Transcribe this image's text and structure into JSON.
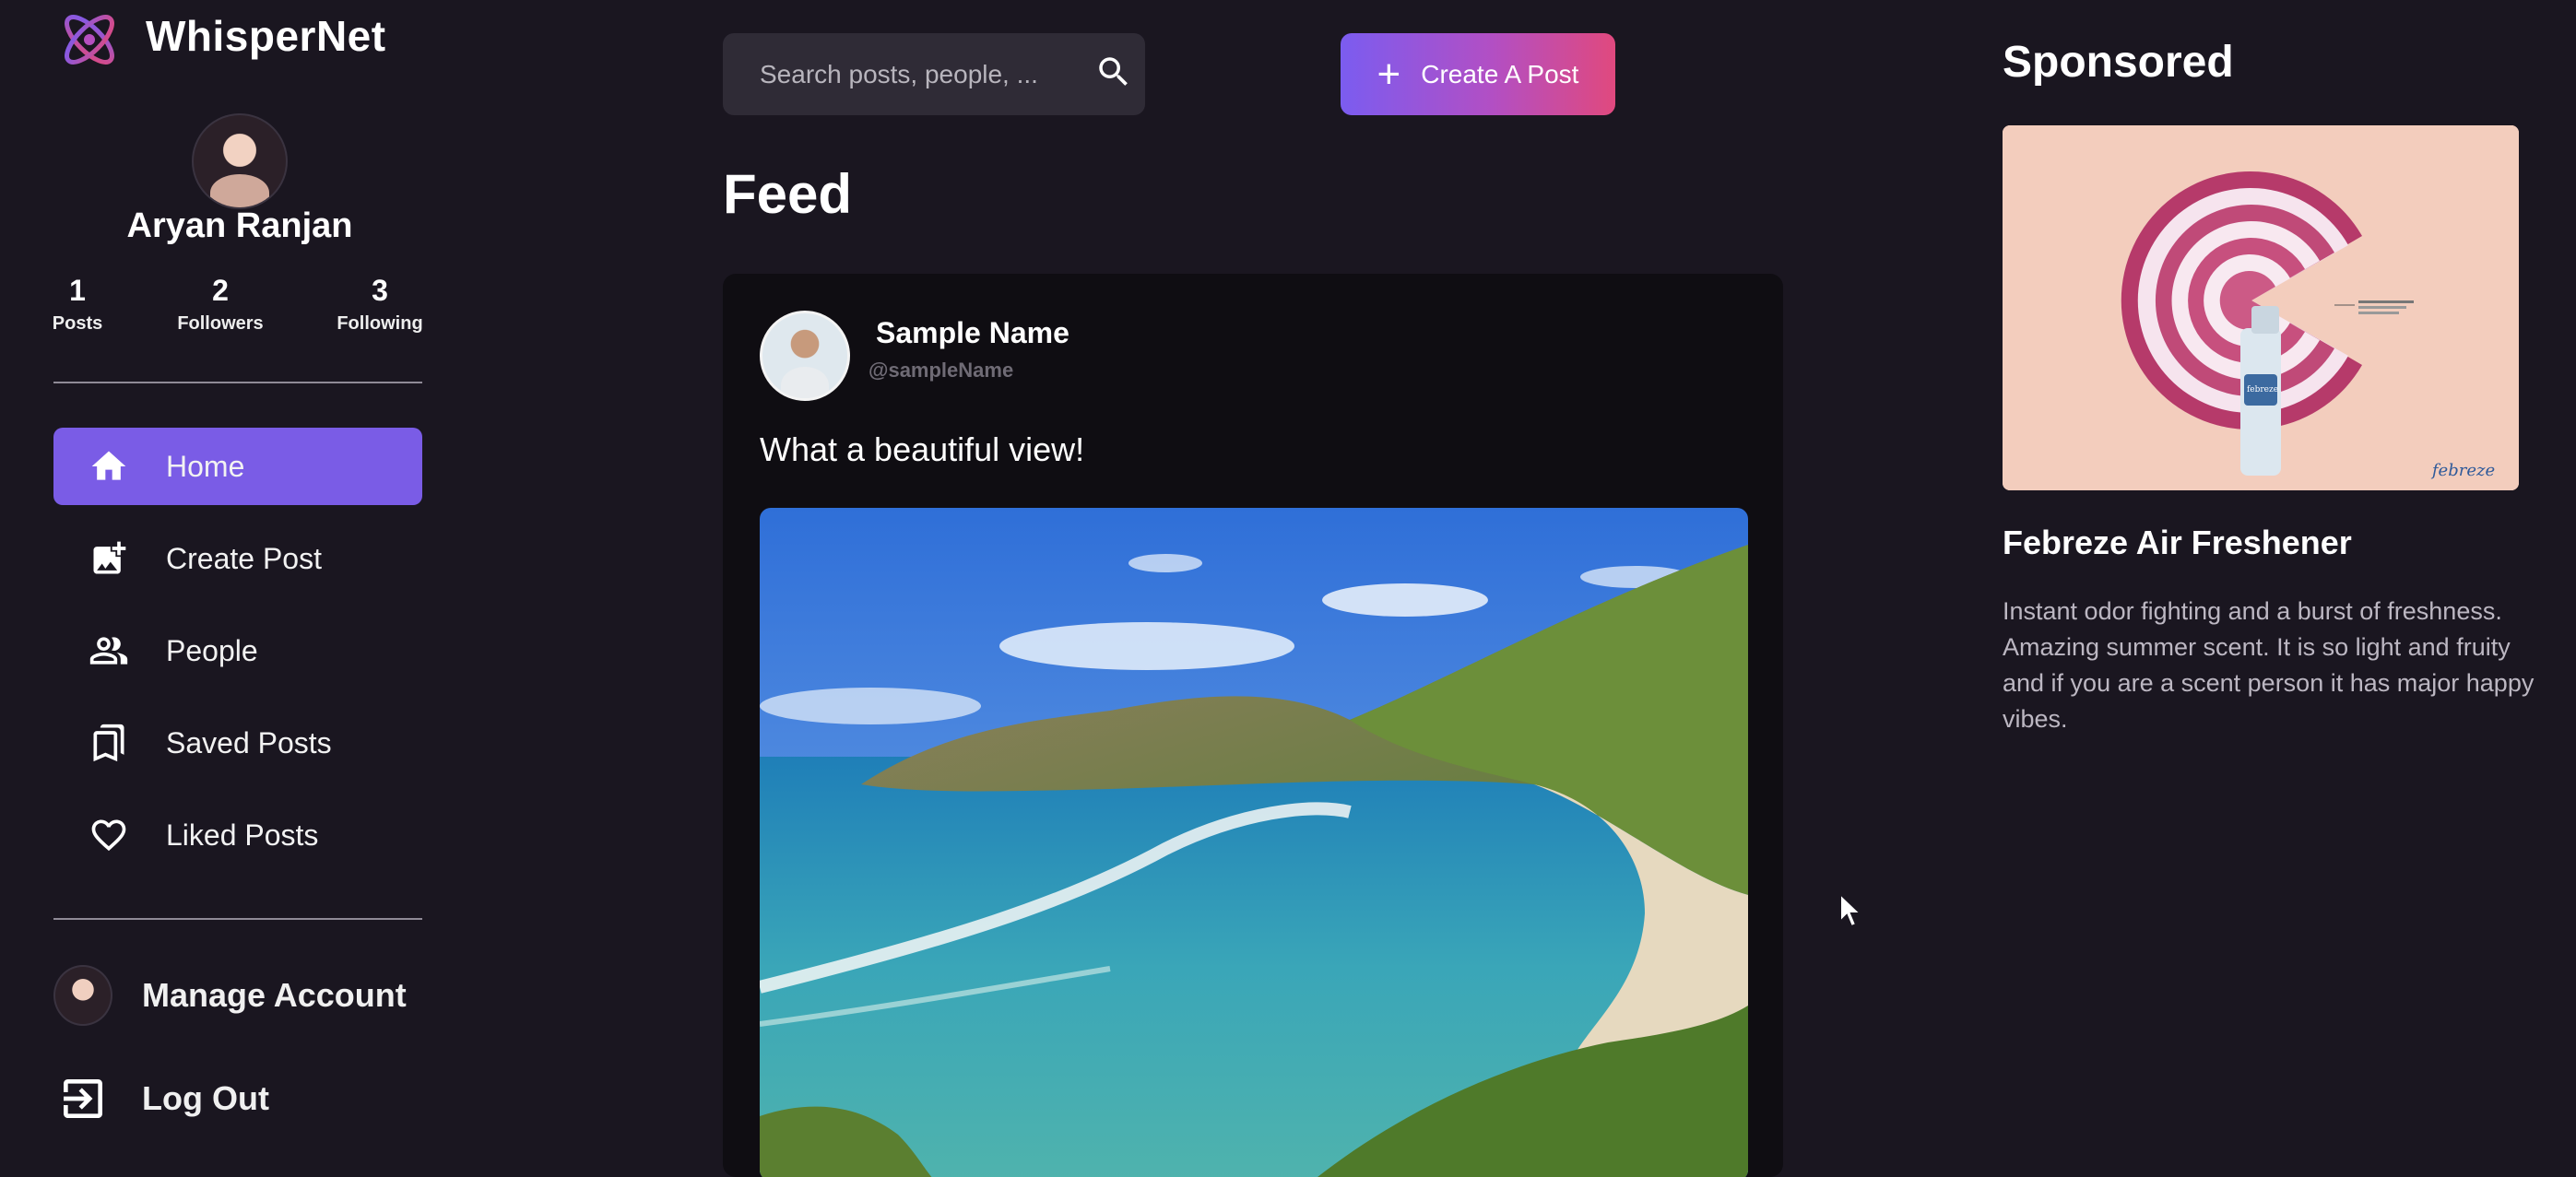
{
  "app": {
    "brand": "WhisperNet",
    "accent": "#7a5ce6"
  },
  "profile": {
    "name": "Aryan Ranjan",
    "stats": [
      {
        "value": "1",
        "label": "Posts"
      },
      {
        "value": "2",
        "label": "Followers"
      },
      {
        "value": "3",
        "label": "Following"
      }
    ]
  },
  "sidebar": {
    "items": [
      {
        "label": "Home",
        "icon": "home-icon",
        "active": true
      },
      {
        "label": "Create Post",
        "icon": "add-photo-icon",
        "active": false
      },
      {
        "label": "People",
        "icon": "people-icon",
        "active": false
      },
      {
        "label": "Saved Posts",
        "icon": "bookmark-icon",
        "active": false
      },
      {
        "label": "Liked Posts",
        "icon": "heart-icon",
        "active": false
      }
    ],
    "bottom": {
      "manage_account": "Manage Account",
      "logout": "Log Out"
    }
  },
  "header": {
    "search_placeholder": "Search posts, people, ...",
    "create_label": "Create A Post",
    "create_gradient": [
      "#7b5cf0",
      "#e0497e"
    ]
  },
  "feed": {
    "title": "Feed",
    "post": {
      "author_name": "Sample Name",
      "author_handle": "@sampleName",
      "caption": "What a beautiful view!",
      "image": "coastal-bay-landscape"
    }
  },
  "sponsored": {
    "title": "Sponsored",
    "ad_title": "Febreze Air Freshener",
    "ad_description": "Instant odor fighting and a burst of freshness. Amazing summer scent. It is so light and fruity and if you are a scent person it has major happy vibes.",
    "ad_image": "febreze-onion-ad",
    "ad_brand_mark": "febreze"
  }
}
